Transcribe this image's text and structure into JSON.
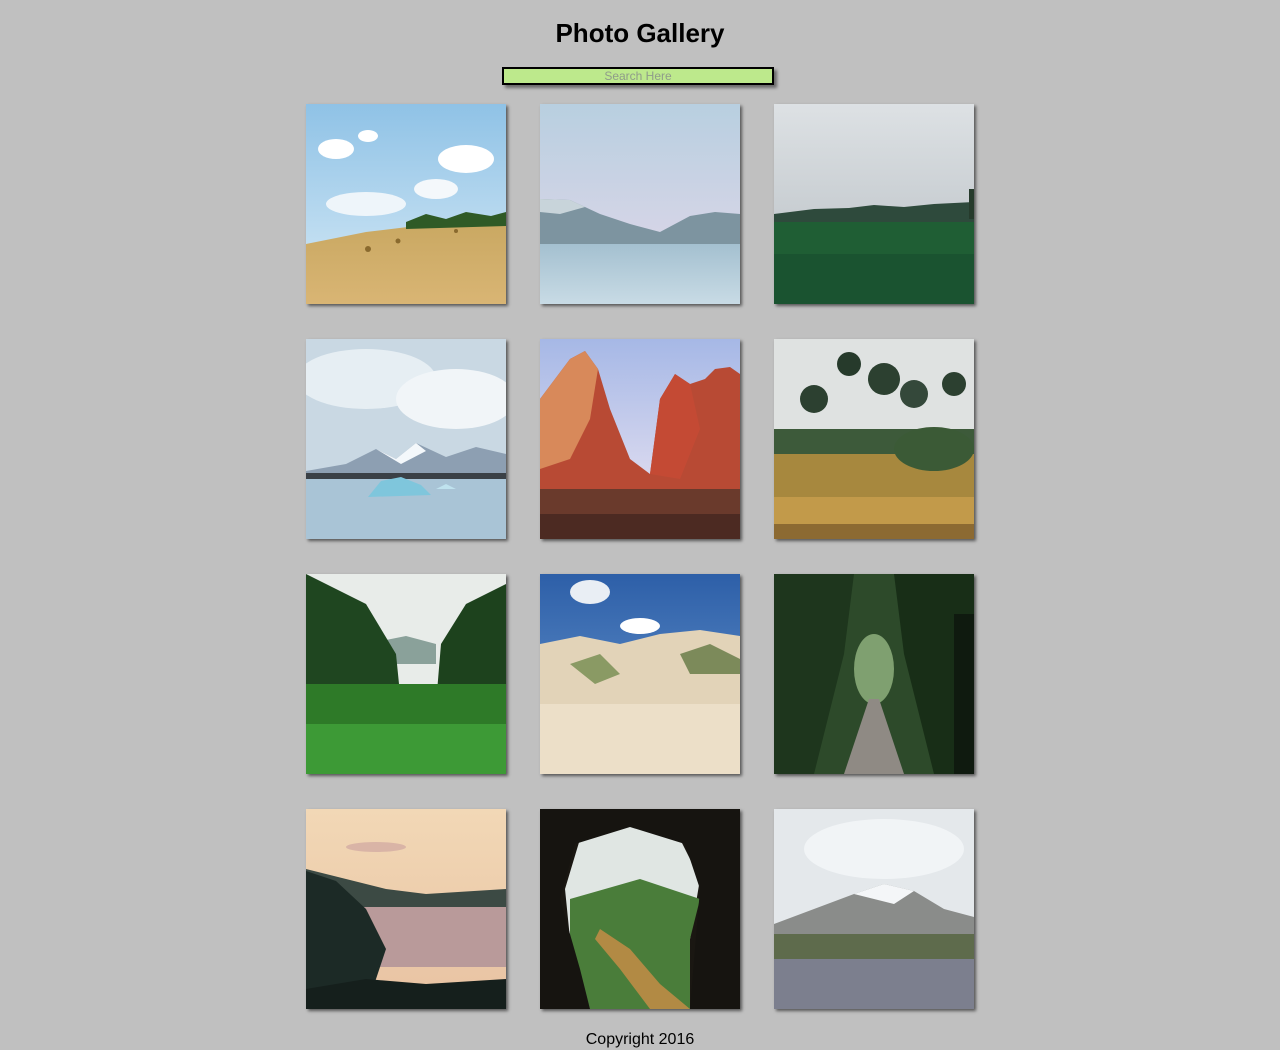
{
  "header": {
    "title": "Photo Gallery"
  },
  "search": {
    "placeholder": "Search Here",
    "value": "",
    "background_color": "#bde98c"
  },
  "gallery": {
    "photos": [
      {
        "subject": "hay-field-photo"
      },
      {
        "subject": "lake-mountains-photo"
      },
      {
        "subject": "green-meadow-photo"
      },
      {
        "subject": "glacier-lagoon-photo"
      },
      {
        "subject": "red-canyon-cliffs-photo"
      },
      {
        "subject": "garden-trees-photo"
      },
      {
        "subject": "jungle-valley-photo"
      },
      {
        "subject": "sand-dunes-photo"
      },
      {
        "subject": "forest-path-photo"
      },
      {
        "subject": "coastal-sunset-photo"
      },
      {
        "subject": "cave-valley-view-photo"
      },
      {
        "subject": "snowy-mountain-lupines-photo"
      }
    ]
  },
  "footer": {
    "text": "Copyright 2016"
  },
  "colors": {
    "page_background": "#c0c0c0"
  }
}
